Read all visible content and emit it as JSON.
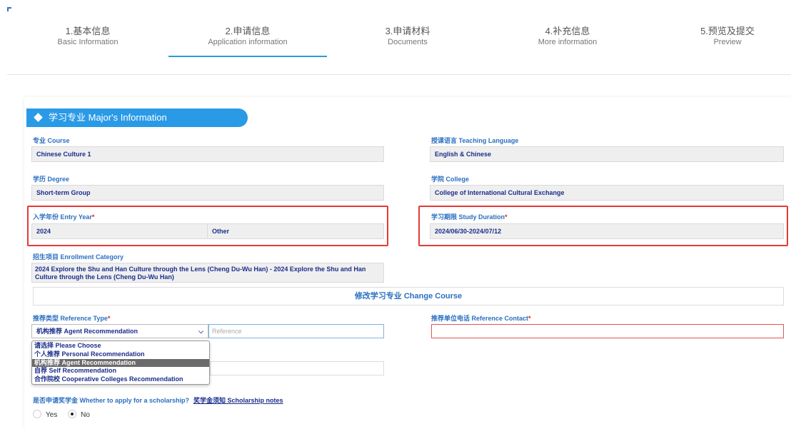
{
  "steps": [
    {
      "cn": "1.基本信息",
      "en": "Basic Information"
    },
    {
      "cn": "2.申请信息",
      "en": "Application information"
    },
    {
      "cn": "3.申请材料",
      "en": "Documents"
    },
    {
      "cn": "4.补充信息",
      "en": "More information"
    },
    {
      "cn": "5.预览及提交",
      "en": "Preview"
    }
  ],
  "active_step_index": 1,
  "section": {
    "title": "学习专业 Major's Information"
  },
  "fields": {
    "course": {
      "label": "专业 Course",
      "value": "Chinese Culture 1"
    },
    "teaching_language": {
      "label": "授课语言 Teaching Language",
      "value": "English & Chinese"
    },
    "degree": {
      "label": "学历 Degree",
      "value": "Short-term Group"
    },
    "college": {
      "label": "学院 College",
      "value": "College of International Cultural Exchange"
    },
    "entry_year": {
      "label": "入学年份 Entry Year",
      "value": "2024",
      "value2": "Other"
    },
    "study_duration": {
      "label": "学习期限 Study Duration",
      "value": "2024/06/30-2024/07/12"
    },
    "enrollment_category": {
      "label": "招生项目 Enrollment Category",
      "value": "2024 Explore the Shu and Han Culture through the Lens (Cheng Du-Wu Han) - 2024 Explore the Shu and Han Culture through the Lens (Cheng Du-Wu Han)"
    },
    "reference_type": {
      "label": "推荐类型 Reference Type",
      "value": "机构推荐 Agent Recommendation"
    },
    "reference": {
      "placeholder": "Reference"
    },
    "reference_contact": {
      "label": "推荐单位电话 Reference Contact"
    }
  },
  "required_mark": "*",
  "change_course": {
    "label": "修改学习专业 Change Course"
  },
  "reference_type_options": [
    "请选择 Please Choose",
    "个人推荐 Personal Recommendation",
    "机构推荐 Agent Recommendation",
    "自荐 Self Recommendation",
    "合作院校 Cooperative Colleges Recommendation"
  ],
  "selected_option_index": 2,
  "scholarship": {
    "question": "是否申请奖学金 Whether to apply for a scholarship?",
    "notes_link": "奖学金须知 Scholarship notes",
    "options": [
      "Yes",
      "No"
    ],
    "selected": "No"
  },
  "colors": {
    "accent": "#2a9ae6",
    "highlight": "#e53935",
    "value_text": "#1b2e8a"
  }
}
